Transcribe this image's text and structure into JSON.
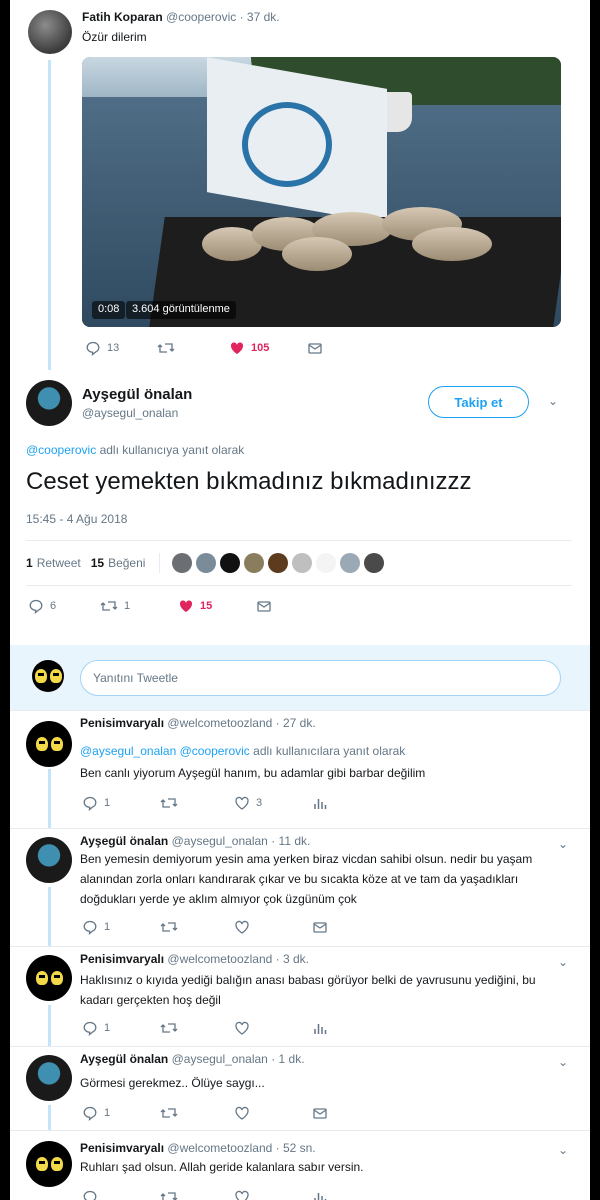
{
  "parent_tweet": {
    "name": "Fatih Koparan",
    "handle": "@cooperovic",
    "time": "· 37 dk.",
    "text": "Özür dilerim",
    "video_duration": "0:08",
    "video_views": "3.604 görüntülenme",
    "replies": "13",
    "retweets": "",
    "likes": "105"
  },
  "main_tweet": {
    "name": "Ayşegül önalan",
    "handle": "@aysegul_onalan",
    "follow_label": "Takip et",
    "reply_to_handle": "@cooperovic",
    "reply_to_suffix": "adlı kullanıcıya yanıt olarak",
    "text": "Ceset yemekten bıkmadınız bıkmadınızzz",
    "timestamp": "15:45 - 4 Ağu 2018",
    "retweet_count": "1",
    "retweet_label": "Retweet",
    "like_count": "15",
    "like_label": "Beğeni",
    "replies": "6",
    "retweets": "1",
    "likes": "15"
  },
  "reply_box": {
    "placeholder": "Yanıtını Tweetle"
  },
  "replies": [
    {
      "name": "Penisimvaryalı",
      "handle": "@welcometoozland",
      "time": "· 27 dk.",
      "reply_to": "@aysegul_onalan @cooperovic",
      "reply_to_suffix": "adlı kullanıcılara yanıt olarak",
      "text": "Ben canlı yiyorum Ayşegül hanım, bu adamlar gibi barbar değilim",
      "replies": "1",
      "likes": "3"
    },
    {
      "name": "Ayşegül önalan",
      "handle": "@aysegul_onalan",
      "time": "· 11 dk.",
      "text": "Ben yemesin demiyorum yesin ama yerken biraz vicdan sahibi olsun.  nedir bu yaşam alanından zorla onları kandırarak çıkar ve bu sıcakta köze at ve tam da yaşadıkları doğdukları yerde ye aklım almıyor çok üzgünüm çok",
      "replies": "1"
    },
    {
      "name": "Penisimvaryalı",
      "handle": "@welcometoozland",
      "time": "· 3 dk.",
      "text": "Haklısınız o kıyıda yediği balığın anası babası görüyor belki de yavrusunu yediğini, bu kadarı gerçekten hoş değil",
      "replies": "1"
    },
    {
      "name": "Ayşegül önalan",
      "handle": "@aysegul_onalan",
      "time": "· 1 dk.",
      "text": "Görmesi gerekmez.. Ölüye saygı...",
      "replies": "1"
    },
    {
      "name": "Penisimvaryalı",
      "handle": "@welcometoozland",
      "time": "· 52 sn.",
      "text": "Ruhları şad olsun. Allah geride kalanlara sabır versin."
    }
  ],
  "colors": {
    "accent": "#1da1f2",
    "like": "#e0245e",
    "muted": "#657786",
    "thread_line": "#c4e4f7"
  }
}
